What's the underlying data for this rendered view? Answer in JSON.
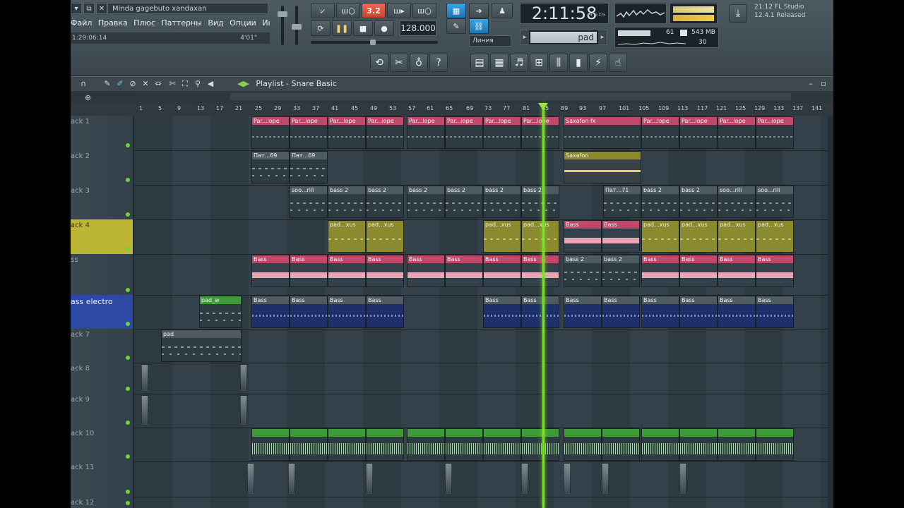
{
  "window": {
    "title": "Minda gagebuto xandaxan",
    "buttons": [
      "▾",
      "⧉",
      "✕"
    ]
  },
  "menu": [
    "Файл",
    "Правка",
    "Плюс",
    "Паттерны",
    "Вид",
    "Опции",
    "Инструменты",
    "?"
  ],
  "hint": {
    "left": "1:29:06:14",
    "right": "4'01\""
  },
  "transport": {
    "tempo": "128.000",
    "time": "2:11:58",
    "time_unit": "M:S:CS",
    "pattern_display": "3.2",
    "snap": "Линия",
    "pattern": "pad"
  },
  "stats": {
    "cpu": "61",
    "memory": "543 MB",
    "poly": "30"
  },
  "version": {
    "time": "21:12",
    "app": "FL Studio",
    "build": "12.4.1 Released"
  },
  "playlist": {
    "title": "Playlist - Snare Basic",
    "ruler": [
      "1",
      "5",
      "9",
      "13",
      "17",
      "21",
      "25",
      "29",
      "33",
      "37",
      "41",
      "45",
      "49",
      "53",
      "57",
      "61",
      "65",
      "69",
      "73",
      "77",
      "81",
      "85",
      "89",
      "93",
      "97",
      "101",
      "105",
      "109",
      "113",
      "117",
      "121",
      "125",
      "129",
      "133",
      "137",
      "141"
    ]
  },
  "colors": {
    "clip_pink": "#c04868",
    "clip_green": "#3f9a3a",
    "clip_gray": "#4f5b63",
    "clip_olive": "#8a8a2a",
    "playhead": "#80e030"
  },
  "tracks": [
    {
      "name": "ack 1"
    },
    {
      "name": "ack 2"
    },
    {
      "name": "ack 3"
    },
    {
      "name": "ack 4"
    },
    {
      "name": "ss"
    },
    {
      "name": "ass electro"
    },
    {
      "name": "ack 7"
    },
    {
      "name": "ack 8"
    },
    {
      "name": "ack 9"
    },
    {
      "name": "ack 10"
    },
    {
      "name": "ack 11"
    },
    {
      "name": "ack 12"
    }
  ],
  "clip_labels": {
    "par": "Par...lope",
    "saxfx": "Saxafon fx",
    "pat69": "Пат...69",
    "sax": "Saxafon",
    "soo": "soo...rili",
    "bass2": "bass 2",
    "pat71": "Пат...71",
    "padxus": "pad...xus",
    "bass": "Bass",
    "padw": "pad_w",
    "pad": "pad"
  }
}
